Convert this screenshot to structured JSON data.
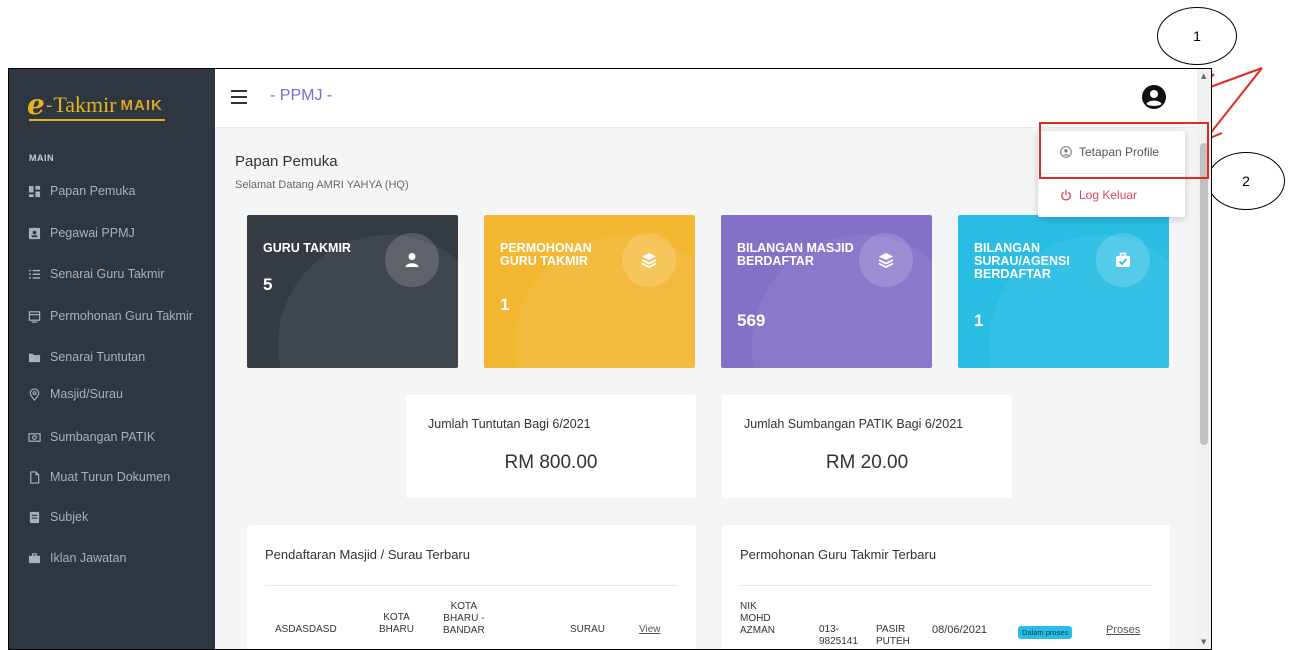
{
  "annotations": {
    "one": "1",
    "two": "2"
  },
  "app": {
    "logo": {
      "e": "e",
      "dash": "-",
      "takmir": "Takmir",
      "maik": "MAIK"
    },
    "topbar": {
      "title": "- PPMJ -"
    }
  },
  "sidebar": {
    "heading": "MAIN",
    "items": [
      {
        "label": "Papan Pemuka",
        "icon": "dashboard-icon"
      },
      {
        "label": "Pegawai PPMJ",
        "icon": "id-card-icon"
      },
      {
        "label": "Senarai Guru Takmir",
        "icon": "list-icon"
      },
      {
        "label": "Permohonan Guru Takmir",
        "icon": "window-icon"
      },
      {
        "label": "Senarai Tuntutan",
        "icon": "folder-icon"
      },
      {
        "label": "Masjid/Surau",
        "icon": "location-pin-icon"
      },
      {
        "label": "Sumbangan PATIK",
        "icon": "money-icon"
      },
      {
        "label": "Muat Turun Dokumen",
        "icon": "document-icon"
      },
      {
        "label": "Subjek",
        "icon": "book-icon"
      },
      {
        "label": "Iklan Jawatan",
        "icon": "briefcase-icon"
      }
    ]
  },
  "main": {
    "page_title": "Papan Pemuka",
    "welcome": "Selamat Datang AMRI YAHYA (HQ)",
    "cards": [
      {
        "label": "GURU TAKMIR",
        "value": "5",
        "color": "#353b43",
        "icon": "user-icon"
      },
      {
        "label": "PERMOHONAN GURU TAKMIR",
        "value": "1",
        "color": "#f3b731",
        "icon": "layers-icon"
      },
      {
        "label": "BILANGAN MASJID BERDAFTAR",
        "value": "569",
        "color": "#8570c8",
        "icon": "layers-icon"
      },
      {
        "label": "BILANGAN SURAU/AGENSI BERDAFTAR",
        "value": "1",
        "color": "#29bde4",
        "icon": "briefcase-check-icon"
      }
    ],
    "summaries": [
      {
        "title": "Jumlah Tuntutan Bagi 6/2021",
        "value": "RM 800.00"
      },
      {
        "title": "Jumlah Sumbangan PATIK Bagi 6/2021",
        "value": "RM 20.00"
      }
    ],
    "table_masjid": {
      "title": "Pendaftaran Masjid / Surau Terbaru",
      "row": {
        "name": "ASDASDASD",
        "district_l1": "KOTA",
        "district_l2": "BHARU",
        "area_l1": "KOTA",
        "area_l2": "BHARU -",
        "area_l3": "BANDAR",
        "type": "SURAU",
        "action": "View"
      }
    },
    "table_guru": {
      "title": "Permohonan Guru Takmir Terbaru",
      "row": {
        "nik_l1": "NIK",
        "nik_l2": "MOHD",
        "nik_l3": "AZMAN",
        "phone_l1": "013-",
        "phone_l2": "9825141",
        "place_l1": "PASIR",
        "place_l2": "PUTEH",
        "date": "08/06/2021",
        "status": "Dalam proses",
        "action": "Proses"
      }
    }
  },
  "dropdown": {
    "profile_label": "Tetapan Profile",
    "logout_label": "Log Keluar"
  },
  "colors": {
    "sidebar": "#2d3641",
    "accent": "#7a6ad8",
    "logout": "#e0455a",
    "annotation": "#e32a1e"
  }
}
